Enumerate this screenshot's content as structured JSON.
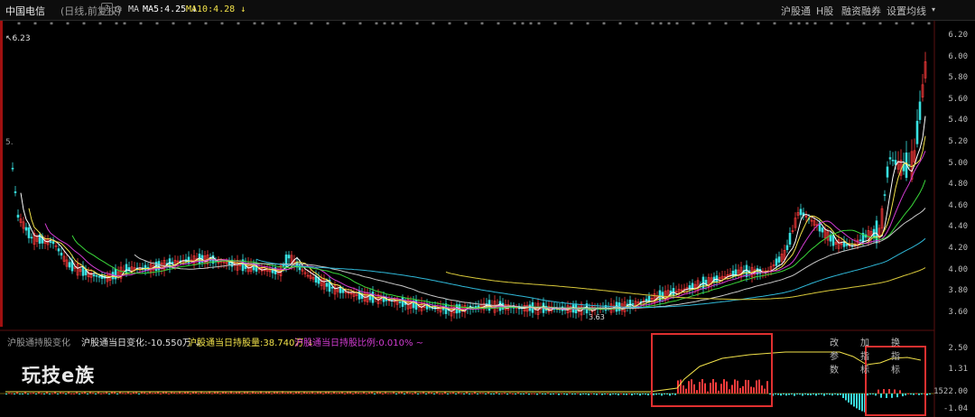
{
  "header": {
    "stock_name": "中国电信",
    "period": "(日线,前复权)",
    "help_icon_text": "?",
    "ma_label": "MA",
    "ma5": "MA5:4.25",
    "ma10": "MA10:4.28",
    "tabs": [
      "沪股通",
      "H股",
      "融资融券",
      "设置均线"
    ],
    "colors": {
      "ma5": "#ffffff",
      "ma10": "#f2e24a"
    }
  },
  "main_chart": {
    "high_marker": "6.23",
    "low_marker": "3.63",
    "left_axis_label": "5.",
    "y_ticks": [
      "6.20",
      "6.00",
      "5.80",
      "5.60",
      "5.40",
      "5.20",
      "5.00",
      "4.80",
      "4.60",
      "4.40",
      "4.20",
      "4.00",
      "3.80",
      "3.60"
    ]
  },
  "sub_chart": {
    "indicator_name": "沪股通持股变化",
    "daily_change": "沪股通当日变化:-10.550万",
    "holding_volume": "沪股通当日持股量:38.740万",
    "holding_ratio": "沪股通当日持股比例:0.010%",
    "tools": [
      "改参数",
      "加指标",
      "换指标"
    ],
    "y_ticks": [
      "2.50",
      "1.31",
      "1522.00",
      "-1.04"
    ],
    "colors": {
      "change": "#e0e0e0",
      "holding": "#f2e24a",
      "ratio": "#d23cd2",
      "highlight": "#e03030"
    }
  },
  "watermark": "玩技e族"
}
